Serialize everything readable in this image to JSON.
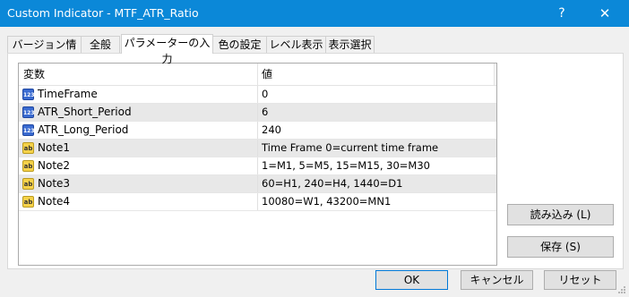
{
  "window": {
    "title": "Custom Indicator - MTF_ATR_Ratio",
    "help": "?",
    "close": "✕"
  },
  "tabs": [
    {
      "label": "バージョン情報"
    },
    {
      "label": "全般"
    },
    {
      "label": "パラメーターの入力"
    },
    {
      "label": "色の設定"
    },
    {
      "label": "レベル表示"
    },
    {
      "label": "表示選択"
    }
  ],
  "active_tab": "パラメーターの入力",
  "table": {
    "headers": [
      "変数",
      "値"
    ],
    "rows": [
      {
        "icon": "numeric-parameter-icon",
        "icon_text": "123",
        "name": "TimeFrame",
        "value": "0"
      },
      {
        "icon": "numeric-parameter-icon",
        "icon_text": "123",
        "name": "ATR_Short_Period",
        "value": "6"
      },
      {
        "icon": "numeric-parameter-icon",
        "icon_text": "123",
        "name": "ATR_Long_Period",
        "value": "240"
      },
      {
        "icon": "string-parameter-icon",
        "icon_text": "ab",
        "name": "Note1",
        "value": "Time Frame 0=current time frame"
      },
      {
        "icon": "string-parameter-icon",
        "icon_text": "ab",
        "name": "Note2",
        "value": "1=M1, 5=M5, 15=M15, 30=M30"
      },
      {
        "icon": "string-parameter-icon",
        "icon_text": "ab",
        "name": "Note3",
        "value": "60=H1, 240=H4, 1440=D1"
      },
      {
        "icon": "string-parameter-icon",
        "icon_text": "ab",
        "name": "Note4",
        "value": "10080=W1, 43200=MN1"
      }
    ]
  },
  "buttons": {
    "load": "読み込み (L)",
    "save": "保存 (S)",
    "ok": "OK",
    "cancel": "キャンセル",
    "reset": "リセット"
  },
  "colors": {
    "titlebar": "#0b88d8",
    "row_shade": "#e8e8e8",
    "ok_border": "#0078d7"
  }
}
